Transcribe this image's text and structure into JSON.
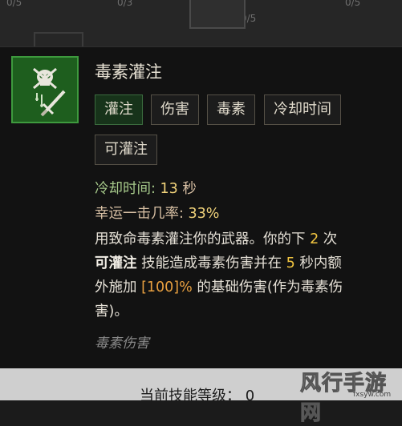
{
  "background": {
    "cells": [
      "0/5",
      "0/3",
      "0/5",
      "0/5"
    ]
  },
  "skill": {
    "icon": "poison-skull-dagger-icon",
    "title": "毒素灌注",
    "tags": [
      "灌注",
      "伤害",
      "毒素",
      "冷却时间",
      "可灌注"
    ],
    "active_tag": "灌注",
    "cooldown_label": "冷却时间:",
    "cooldown_value": "13",
    "cooldown_unit": "秒",
    "lucky_label": "幸运一击几率:",
    "lucky_value": "33%",
    "desc": {
      "l1_a": "用致命毒素灌注你的武器。你的下",
      "l1_num": "2",
      "l1_b": "次",
      "l2_kw": "可灌注",
      "l2_a": "技能造成毒素伤害并在",
      "l2_num": "5",
      "l2_b": "秒内额",
      "l3_a": "外施加",
      "l3_pct": "[100]%",
      "l3_b": "的基础伤害(作为毒素伤",
      "l4": "害)。"
    },
    "flavor": "毒素伤害"
  },
  "footer": {
    "level_label": "当前技能等级：",
    "level_value": "0"
  },
  "watermark": {
    "text": "风行手游网",
    "sub": "fxsyw.com"
  },
  "colors": {
    "icon_bg": "#1e5e1e",
    "icon_border": "#3e9a3e",
    "active_tag_bg": "#17331a",
    "number_highlight": "#f0c440",
    "percent_highlight": "#e8a040"
  }
}
